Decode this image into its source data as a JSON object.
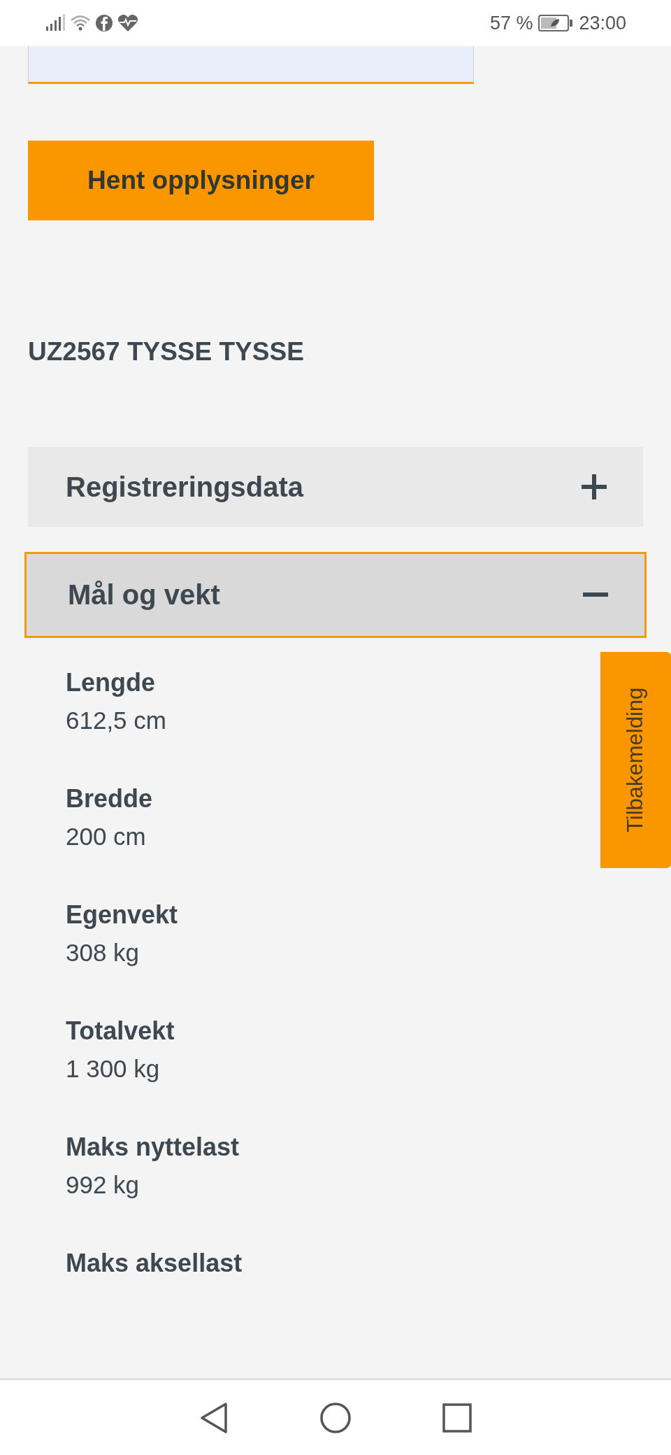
{
  "status_bar": {
    "battery": "57 %",
    "time": "23:00"
  },
  "lookup_button": "Hent opplysninger",
  "vehicle_title": "UZ2567 TYSSE TYSSE",
  "sections": [
    {
      "title": "Registreringsdata",
      "expanded": false
    },
    {
      "title": "Mål og vekt",
      "expanded": true,
      "fields": [
        {
          "label": "Lengde",
          "value": "612,5 cm"
        },
        {
          "label": "Bredde",
          "value": "200 cm"
        },
        {
          "label": "Egenvekt",
          "value": "308 kg"
        },
        {
          "label": "Totalvekt",
          "value": "1 300 kg"
        },
        {
          "label": "Maks nyttelast",
          "value": "992 kg"
        },
        {
          "label": "Maks aksellast"
        }
      ]
    }
  ],
  "feedback_tab": "Tilbakemelding"
}
